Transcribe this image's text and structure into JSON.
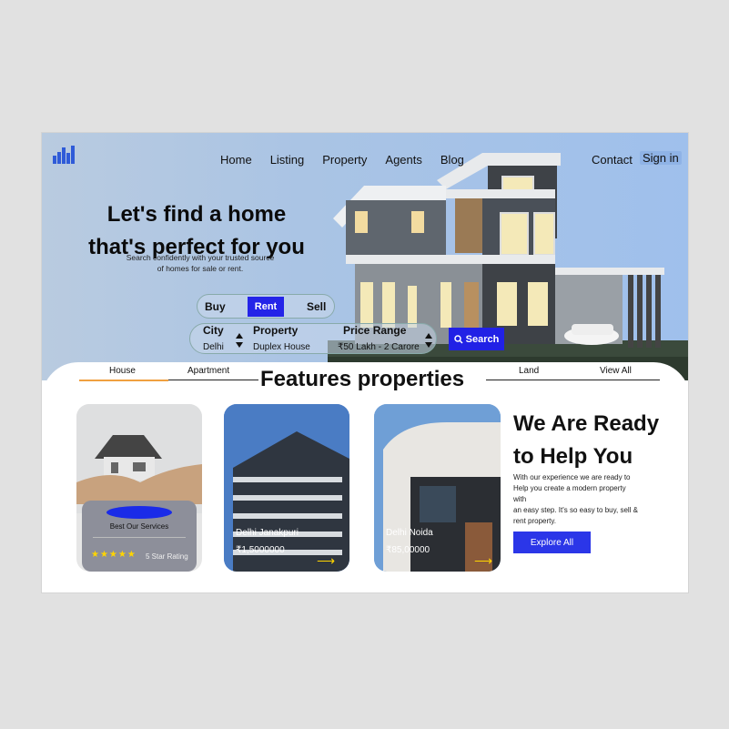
{
  "nav": {
    "home": "Home",
    "listing": "Listing",
    "property": "Property",
    "agents": "Agents",
    "blog": "Blog",
    "contact": "Contact",
    "signin": "Sign in"
  },
  "hero": {
    "headline_line1": "Let's find a home",
    "headline_line2": "that's perfect for you",
    "subtitle_line1": "Search confidently with your trusted source",
    "subtitle_line2": "of homes for sale or rent."
  },
  "search": {
    "tabs": {
      "buy": "Buy",
      "rent": "Rent",
      "sell": "Sell"
    },
    "city_label": "City",
    "city_value": "Delhi",
    "property_label": "Property",
    "property_value": "Duplex House",
    "price_label": "Price Range",
    "price_value": "₹50 Lakh - 2 Carore",
    "button": "Search"
  },
  "categories": {
    "house": "House",
    "apartment": "Apartment",
    "title": "Features properties",
    "land": "Land",
    "view_all": "View All"
  },
  "cards": {
    "service_title": "Best Our Services",
    "stars": "★★★★★",
    "rating_text": "5 Star Rating",
    "card2_name": "Delhi Janakpuri",
    "card2_price": "₹1,5000000",
    "card3_name": "Delhi Noida",
    "card3_price": "₹85,00000"
  },
  "help": {
    "title_line1": "We Are Ready",
    "title_line2": "to Help You",
    "text_line1": "With our experience we are ready to",
    "text_line2": "Help you create a modern property",
    "text_line3": "with",
    "text_line4": "an easy step. It's so easy to buy, sell &",
    "text_line5": "rent property.",
    "button": "Explore All"
  },
  "colors": {
    "accent_blue": "#2424e8",
    "tab_underline": "#f0a040",
    "star": "#ffd500"
  }
}
